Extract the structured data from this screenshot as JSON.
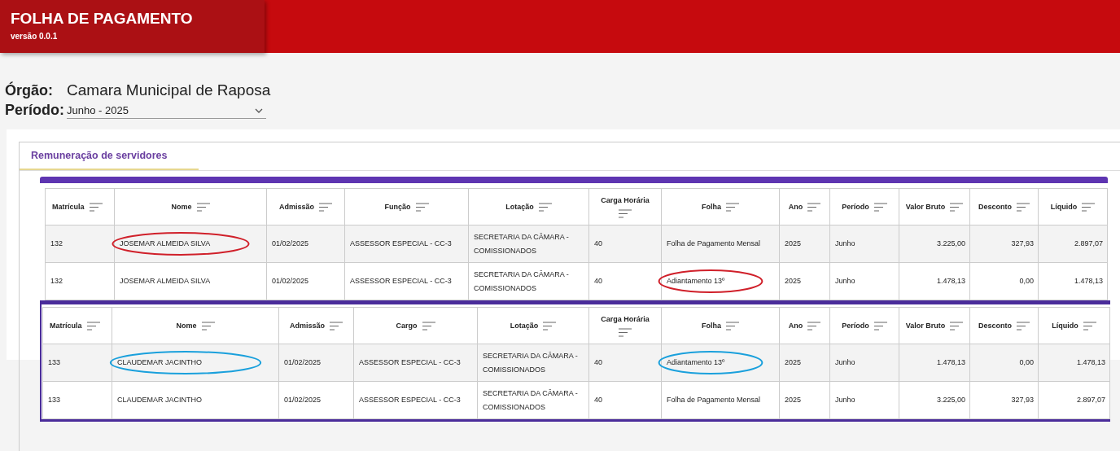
{
  "header": {
    "title": "FOLHA DE PAGAMENTO",
    "version": "versão 0.0.1"
  },
  "orgao": {
    "label": "Órgão:",
    "value": "Camara Municipal de Raposa"
  },
  "periodo": {
    "label": "Período:",
    "value": "Junho - 2025"
  },
  "tabs": [
    {
      "label": "Remuneração de servidores",
      "selected": true
    }
  ],
  "tables": [
    {
      "columns": [
        "Matrícula",
        "Nome",
        "Admissão",
        "Função",
        "Lotação",
        "Carga Horária",
        "Folha",
        "Ano",
        "Período",
        "Valor Bruto",
        "Desconto",
        "Líquido"
      ],
      "rows": [
        {
          "cells": [
            {
              "text": "132"
            },
            {
              "text": "JOSEMAR ALMEIDA SILVA",
              "color": "#d0202a"
            },
            {
              "text": "01/02/2025"
            },
            {
              "text": "ASSESSOR ESPECIAL - CC-3"
            },
            {
              "text": "SECRETARIA DA CÂMARA - COMISSIONADOS"
            },
            {
              "text": "40"
            },
            {
              "text": "Folha de Pagamento Mensal"
            },
            {
              "text": "2025"
            },
            {
              "text": "Junho"
            },
            {
              "text": "3.225,00"
            },
            {
              "text": "327,93"
            },
            {
              "text": "2.897,07"
            }
          ]
        },
        {
          "cells": [
            {
              "text": "132"
            },
            {
              "text": "JOSEMAR ALMEIDA SILVA"
            },
            {
              "text": "01/02/2025"
            },
            {
              "text": "ASSESSOR ESPECIAL - CC-3"
            },
            {
              "text": "SECRETARIA DA CÂMARA - COMISSIONADOS"
            },
            {
              "text": "40"
            },
            {
              "text": "Adiantamento 13º",
              "color": "#d0202a"
            },
            {
              "text": "2025"
            },
            {
              "text": "Junho"
            },
            {
              "text": "1.478,13"
            },
            {
              "text": "0,00"
            },
            {
              "text": "1.478,13"
            }
          ]
        }
      ]
    },
    {
      "columns": [
        "Matrícula",
        "Nome",
        "Admissão",
        "Cargo",
        "Lotação",
        "Carga Horária",
        "Folha",
        "Ano",
        "Período",
        "Valor Bruto",
        "Desconto",
        "Líquido"
      ],
      "rows": [
        {
          "cells": [
            {
              "text": "133"
            },
            {
              "text": "CLAUDEMAR JACINTHO",
              "color": "#1aa0dc"
            },
            {
              "text": "01/02/2025"
            },
            {
              "text": "ASSESSOR ESPECIAL - CC-3"
            },
            {
              "text": "SECRETARIA DA CÂMARA - COMISSIONADOS"
            },
            {
              "text": "40"
            },
            {
              "text": "Adiantamento 13º",
              "color": "#1aa0dc"
            },
            {
              "text": "2025"
            },
            {
              "text": "Junho"
            },
            {
              "text": "1.478,13"
            },
            {
              "text": "0,00"
            },
            {
              "text": "1.478,13"
            }
          ]
        },
        {
          "cells": [
            {
              "text": "133"
            },
            {
              "text": "CLAUDEMAR JACINTHO"
            },
            {
              "text": "01/02/2025"
            },
            {
              "text": "ASSESSOR ESPECIAL - CC-3"
            },
            {
              "text": "SECRETARIA DA CÂMARA - COMISSIONADOS"
            },
            {
              "text": "40"
            },
            {
              "text": "Folha de Pagamento Mensal"
            },
            {
              "text": "2025"
            },
            {
              "text": "Junho"
            },
            {
              "text": "3.225,00"
            },
            {
              "text": "327,93"
            },
            {
              "text": "2.897,07"
            }
          ]
        }
      ]
    }
  ]
}
